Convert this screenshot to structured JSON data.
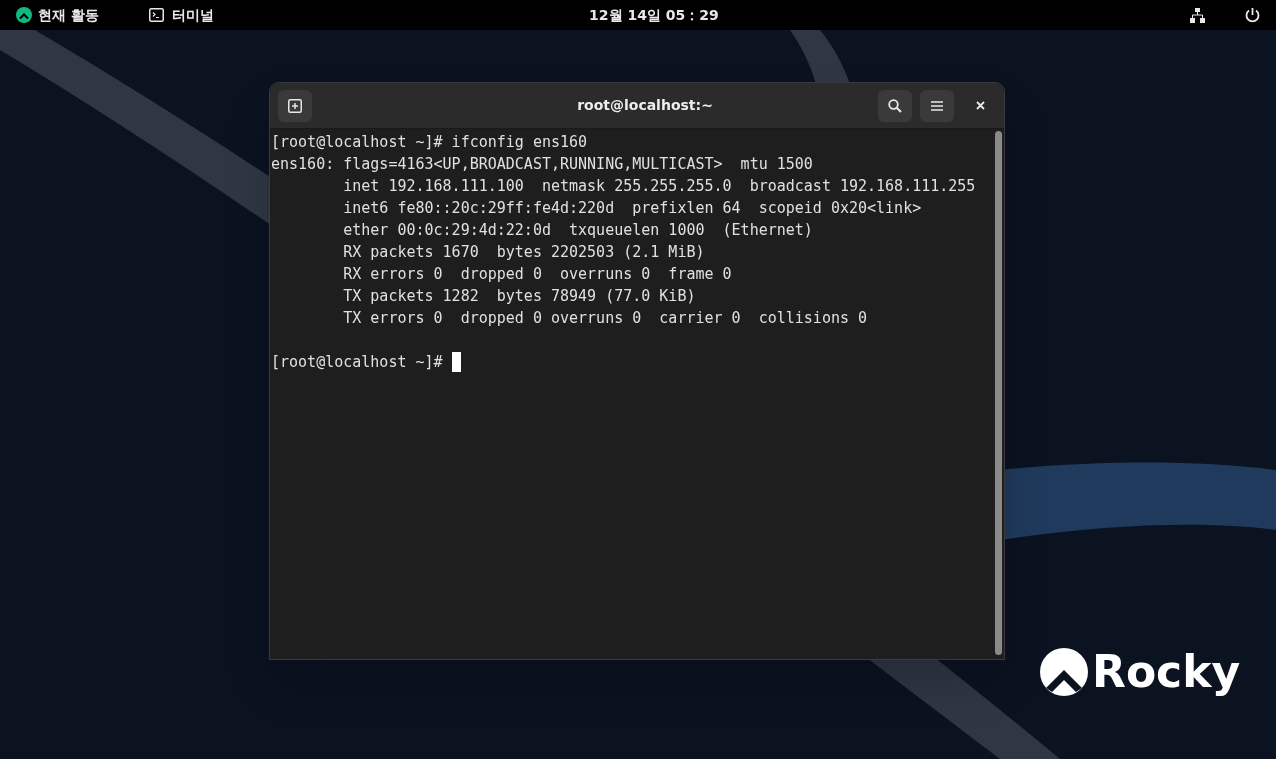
{
  "top_bar": {
    "activities": "현재 활동",
    "app": "터미널",
    "clock": "12월 14일 05：29"
  },
  "window": {
    "title": "root@localhost:~",
    "lines": [
      "[root@localhost ~]# ifconfig ens160",
      "ens160: flags=4163<UP,BROADCAST,RUNNING,MULTICAST>  mtu 1500",
      "        inet 192.168.111.100  netmask 255.255.255.0  broadcast 192.168.111.255",
      "        inet6 fe80::20c:29ff:fe4d:220d  prefixlen 64  scopeid 0x20<link>",
      "        ether 00:0c:29:4d:22:0d  txqueuelen 1000  (Ethernet)",
      "        RX packets 1670  bytes 2202503 (2.1 MiB)",
      "        RX errors 0  dropped 0  overruns 0  frame 0",
      "        TX packets 1282  bytes 78949 (77.0 KiB)",
      "        TX errors 0  dropped 0 overruns 0  carrier 0  collisions 0"
    ],
    "prompt": "[root@localhost ~]# "
  },
  "desktop": {
    "logo_text": "Rocky"
  }
}
